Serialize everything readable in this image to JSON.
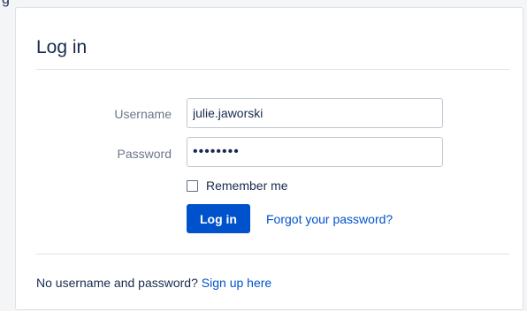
{
  "page": {
    "top_text": "g"
  },
  "login": {
    "title": "Log in",
    "username_label": "Username",
    "username_value": "julie.jaworski",
    "password_label": "Password",
    "password_display": "••••••••",
    "remember_label": "Remember me",
    "login_button": "Log in",
    "forgot_link": "Forgot your password?"
  },
  "footer": {
    "prompt": "No username and password?",
    "signup_link": "Sign up here"
  },
  "colors": {
    "accent": "#0052cc",
    "text": "#172b4d",
    "muted": "#6b778c",
    "border": "#dfe1e6"
  }
}
